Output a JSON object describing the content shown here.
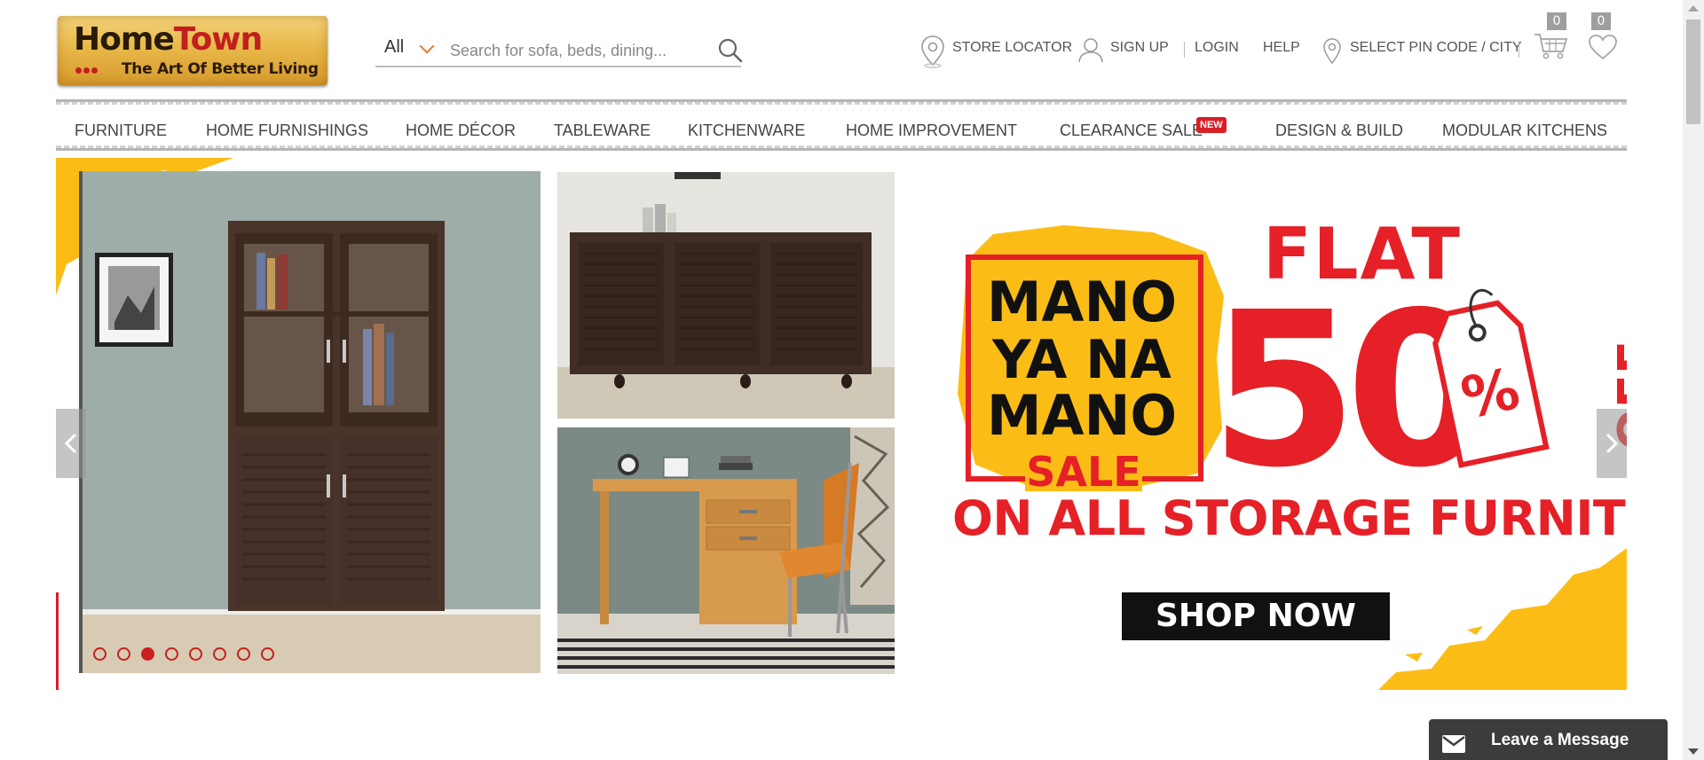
{
  "brand": {
    "name_part1": "Home",
    "name_part2": "Town",
    "tagline": "The Art Of Better Living"
  },
  "search": {
    "category": "All",
    "placeholder": "Search for sofa, beds, dining..."
  },
  "top_links": {
    "store_locator": "STORE LOCATOR",
    "sign_up": "SIGN UP",
    "login": "LOGIN",
    "help": "HELP",
    "pincode": "SELECT PIN CODE / CITY"
  },
  "cart": {
    "count": "0"
  },
  "wishlist": {
    "count": "0"
  },
  "nav": [
    "FURNITURE",
    "HOME FURNISHINGS",
    "HOME DÉCOR",
    "TABLEWARE",
    "KITCHENWARE",
    "HOME IMPROVEMENT",
    "CLEARANCE SALE",
    "DESIGN & BUILD",
    "MODULAR KITCHENS"
  ],
  "nav_badge": "NEW",
  "banner": {
    "mano_1": "MANO",
    "mano_2": "YA NA",
    "mano_3": "MANO",
    "sale": "SALE",
    "flat": "FLAT",
    "fifty": "50",
    "percent": "%",
    "off": "OFF",
    "asterisk": "*",
    "offer_line": "ON ALL STORAGE FURNITURE",
    "cta": "SHOP NOW"
  },
  "slider": {
    "total": 8,
    "active": 3
  },
  "chat": {
    "label": "Leave a Message"
  },
  "colors": {
    "accent_red": "#e52027",
    "accent_yellow": "#fbbd15",
    "chevron_orange": "#e5792b"
  },
  "icons": [
    "search-icon",
    "location-pin-icon",
    "user-icon",
    "cart-icon",
    "heart-icon",
    "chevron-left-icon",
    "chevron-right-icon",
    "mail-icon"
  ]
}
